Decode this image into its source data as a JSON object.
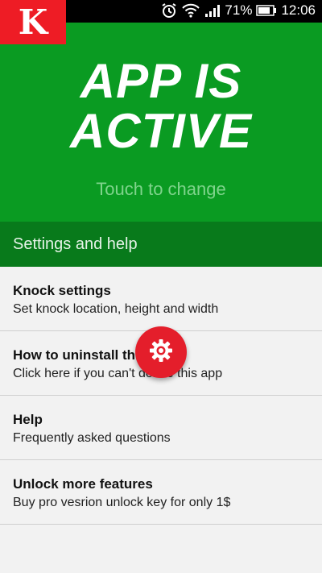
{
  "status_bar": {
    "battery_percent": "71%",
    "time": "12:06"
  },
  "logo": {
    "letter": "K"
  },
  "hero": {
    "title_line1": "APP IS",
    "title_line2": "ACTIVE",
    "subtitle": "Touch to change",
    "bg_color": "#0a9b22"
  },
  "section_header": {
    "label": "Settings and help"
  },
  "items": [
    {
      "title": "Knock settings",
      "subtitle": "Set knock location, height and width"
    },
    {
      "title": "How to uninstall this app?",
      "subtitle": "Click here if you can't delete this app"
    },
    {
      "title": "Help",
      "subtitle": "Frequently asked questions"
    },
    {
      "title": "Unlock more features",
      "subtitle": "Buy pro vesrion unlock key for only 1$"
    }
  ],
  "fab": {
    "icon": "gear-icon",
    "color": "#e41e2b"
  }
}
